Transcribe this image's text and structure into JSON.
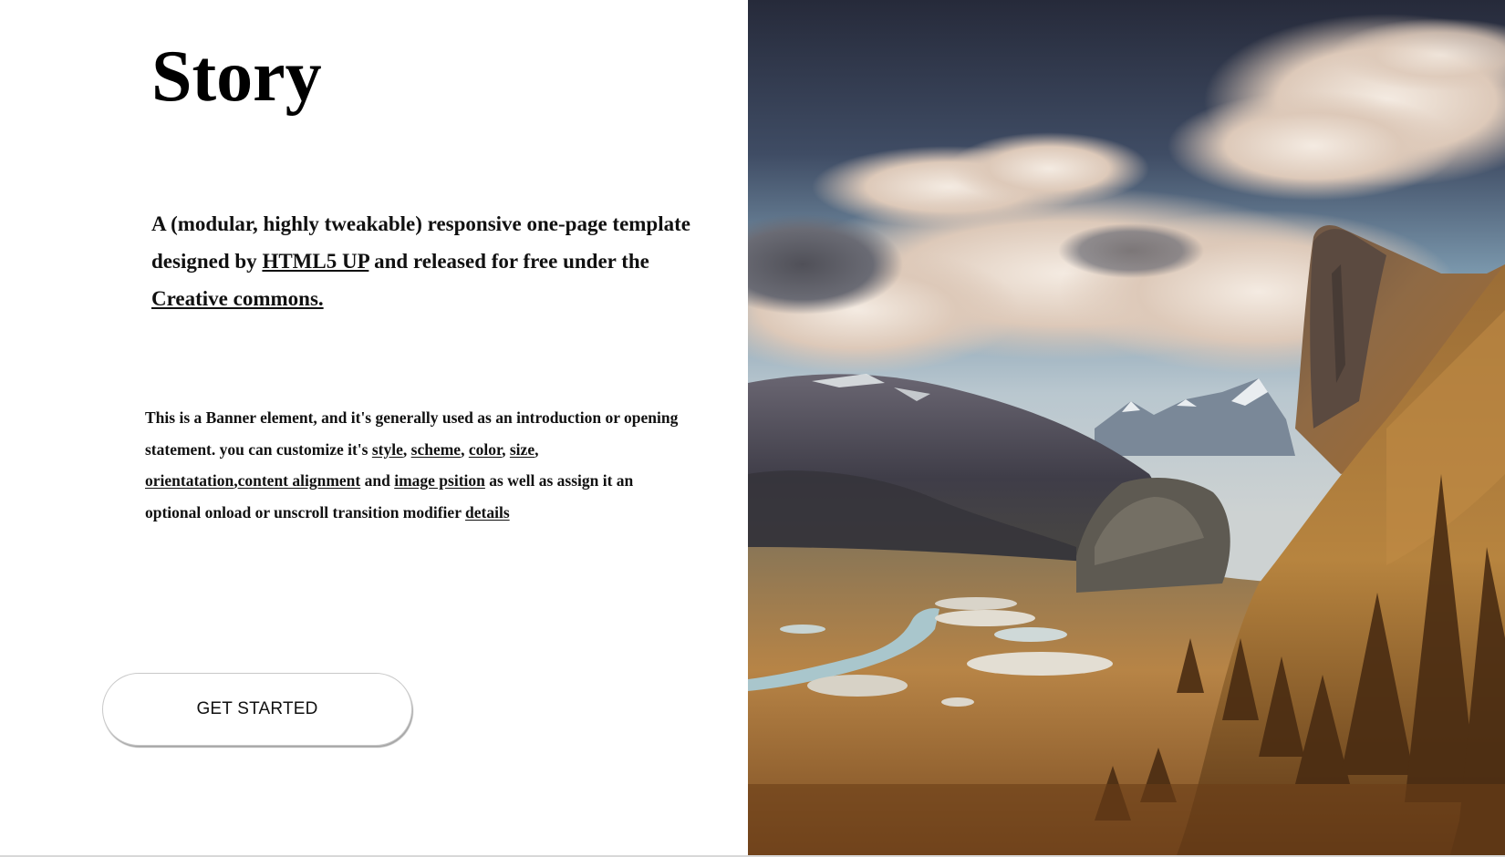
{
  "banner": {
    "title": "Story",
    "lead": {
      "part1": "A (modular, highly tweakable) responsive one-page template designed by ",
      "link1": "HTML5 UP",
      "part2": " and released for free under the ",
      "link2": "Creative commons."
    },
    "body": {
      "part1": "This is a Banner element, and it's generally used as an introduction or opening statement. you can customize it's ",
      "link_style": "style",
      "sep1": ", ",
      "link_scheme": "scheme",
      "sep2": ", ",
      "link_color": "color",
      "sep3": ", ",
      "link_size": "size",
      "sep4": ", ",
      "link_orientation": "orientatation",
      "sep5": ",",
      "link_alignment": "content alignment",
      "part2": " and ",
      "link_image_position": "image psition",
      "part3": " as well as assign it an optional onload or unscroll transition modifier ",
      "link_details": "details"
    },
    "cta_label": "GET STARTED"
  },
  "image": {
    "subject": "mountain-valley-landscape",
    "colors": {
      "sky_top": "#2f3548",
      "sky_mid": "#6f8fa8",
      "cloud": "#e8ddd2",
      "mountain_dark": "#4a4650",
      "valley_gold": "#b07a3c",
      "water": "#a9c6cc"
    }
  }
}
